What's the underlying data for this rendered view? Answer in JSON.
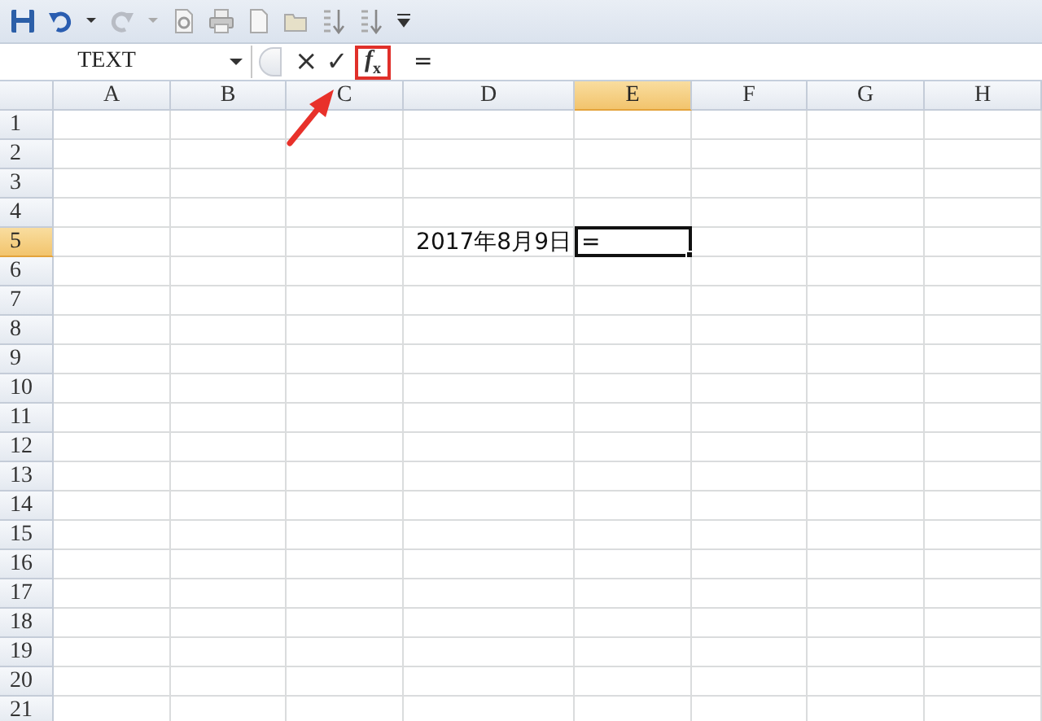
{
  "formula_bar": {
    "name_box": "TEXT",
    "cancel": "×",
    "enter": "✓",
    "fx": "*f*$_{x}$",
    "fx_highlighted": true,
    "formula": "="
  },
  "annotation": {
    "kind": "arrow"
  },
  "columns": [
    {
      "label": "A",
      "selected": false
    },
    {
      "label": "B",
      "selected": false
    },
    {
      "label": "C",
      "selected": false
    },
    {
      "label": "D",
      "selected": false
    },
    {
      "label": "E",
      "selected": true
    },
    {
      "label": "F",
      "selected": false
    },
    {
      "label": "G",
      "selected": false
    },
    {
      "label": "H",
      "selected": false
    }
  ],
  "rows": [
    {
      "label": "1",
      "selected": false
    },
    {
      "label": "2",
      "selected": false
    },
    {
      "label": "3",
      "selected": false
    },
    {
      "label": "4",
      "selected": false
    },
    {
      "label": "5",
      "selected": true,
      "cells": [
        {
          "kind": "blank"
        },
        {
          "kind": "blank"
        },
        {
          "kind": "blank"
        },
        {
          "kind": "value",
          "value": "2017年8月9日",
          "active": false
        },
        {
          "kind": "value",
          "value": "=",
          "active": true
        }
      ]
    },
    {
      "label": "6",
      "selected": false
    },
    {
      "label": "7",
      "selected": false
    },
    {
      "label": "8",
      "selected": false
    },
    {
      "label": "9",
      "selected": false
    },
    {
      "label": "10",
      "selected": false
    },
    {
      "label": "11",
      "selected": false
    },
    {
      "label": "12",
      "selected": false
    },
    {
      "label": "13",
      "selected": false
    },
    {
      "label": "14",
      "selected": false
    },
    {
      "label": "15",
      "selected": false
    },
    {
      "label": "16",
      "selected": false
    },
    {
      "label": "17",
      "selected": false
    },
    {
      "label": "18",
      "selected": false
    },
    {
      "label": "19",
      "selected": false
    },
    {
      "label": "20",
      "selected": false
    },
    {
      "label": "21",
      "selected": false
    }
  ]
}
